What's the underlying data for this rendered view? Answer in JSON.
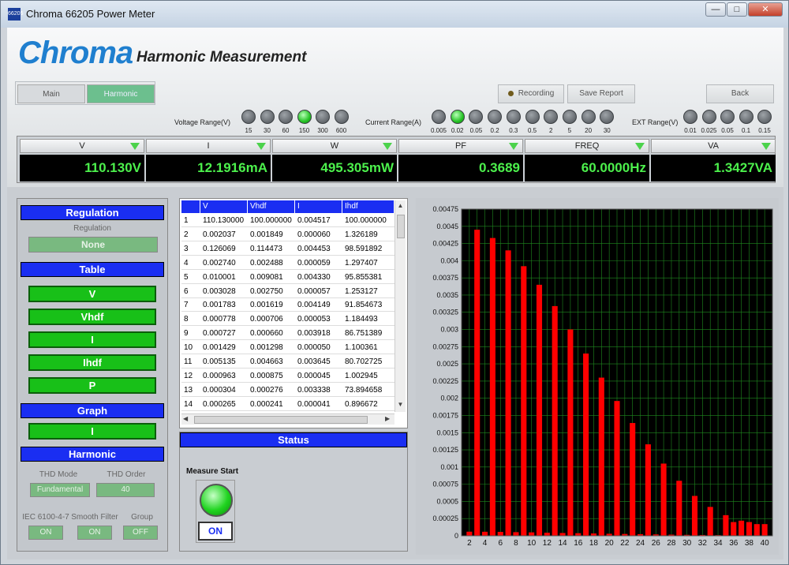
{
  "window": {
    "title": "Chroma 66205 Power Meter",
    "icon_text": "66205",
    "minimize": "—",
    "maximize": "□",
    "close": "✕"
  },
  "header": {
    "logo": "Chroma",
    "subtitle": "Harmonic Measurement",
    "tabs": [
      "Main",
      "Harmonic"
    ],
    "active_tab": "Harmonic",
    "recording_label": "Recording",
    "save_report_label": "Save Report",
    "back_label": "Back"
  },
  "ranges": {
    "voltage": {
      "label": "Voltage Range(V)",
      "options": [
        "15",
        "30",
        "60",
        "150",
        "300",
        "600"
      ],
      "selected": "150"
    },
    "current": {
      "label": "Current Range(A)",
      "options": [
        "0.005",
        "0.02",
        "0.05",
        "0.2",
        "0.3",
        "0.5",
        "2",
        "5",
        "20",
        "30"
      ],
      "selected": "0.02"
    },
    "ext": {
      "label": "EXT Range(V)",
      "options": [
        "0.01",
        "0.025",
        "0.05",
        "0.1",
        "0.15"
      ],
      "selected": ""
    }
  },
  "meters": [
    {
      "name": "V",
      "value": "110.130V"
    },
    {
      "name": "I",
      "value": "12.1916mA"
    },
    {
      "name": "W",
      "value": "495.305mW"
    },
    {
      "name": "PF",
      "value": "0.3689"
    },
    {
      "name": "FREQ",
      "value": "60.0000Hz"
    },
    {
      "name": "VA",
      "value": "1.3427VA"
    }
  ],
  "regulation": {
    "header": "Regulation",
    "label": "Regulation",
    "value": "None"
  },
  "table_section": {
    "header": "Table",
    "buttons": [
      "V",
      "Vhdf",
      "I",
      "Ihdf",
      "P"
    ]
  },
  "graph_section": {
    "header": "Graph",
    "button": "I"
  },
  "harmonic_section": {
    "header": "Harmonic",
    "thd_mode_label": "THD Mode",
    "thd_mode_value": "Fundamental",
    "thd_order_label": "THD Order",
    "thd_order_value": "40",
    "iec_label": "IEC 6100-4-7",
    "iec_value": "ON",
    "smooth_label": "Smooth Filter",
    "smooth_value": "ON",
    "group_label": "Group",
    "group_value": "OFF"
  },
  "data_table": {
    "columns": [
      "",
      "V",
      "Vhdf",
      "I",
      "Ihdf"
    ],
    "rows": [
      [
        "1",
        "110.130000",
        "100.000000",
        "0.004517",
        "100.000000"
      ],
      [
        "2",
        "0.002037",
        "0.001849",
        "0.000060",
        "1.326189"
      ],
      [
        "3",
        "0.126069",
        "0.114473",
        "0.004453",
        "98.591892"
      ],
      [
        "4",
        "0.002740",
        "0.002488",
        "0.000059",
        "1.297407"
      ],
      [
        "5",
        "0.010001",
        "0.009081",
        "0.004330",
        "95.855381"
      ],
      [
        "6",
        "0.003028",
        "0.002750",
        "0.000057",
        "1.253127"
      ],
      [
        "7",
        "0.001783",
        "0.001619",
        "0.004149",
        "91.854673"
      ],
      [
        "8",
        "0.000778",
        "0.000706",
        "0.000053",
        "1.184493"
      ],
      [
        "9",
        "0.000727",
        "0.000660",
        "0.003918",
        "86.751389"
      ],
      [
        "10",
        "0.001429",
        "0.001298",
        "0.000050",
        "1.100361"
      ],
      [
        "11",
        "0.005135",
        "0.004663",
        "0.003645",
        "80.702725"
      ],
      [
        "12",
        "0.000963",
        "0.000875",
        "0.000045",
        "1.002945"
      ],
      [
        "13",
        "0.000304",
        "0.000276",
        "0.003338",
        "73.894658"
      ],
      [
        "14",
        "0.000265",
        "0.000241",
        "0.000041",
        "0.896672"
      ]
    ]
  },
  "status": {
    "header": "Status",
    "measure_label": "Measure Start",
    "measure_value": "ON"
  },
  "colors": {
    "accent_blue": "#1a2ef2",
    "led_on": "#24c224",
    "bar": "#ff0000",
    "plot_bg": "#000000",
    "grid": "#1f8a1f",
    "meter_text": "#4cf04c"
  },
  "chart_data": {
    "type": "bar",
    "title": "",
    "xlabel": "",
    "ylabel": "",
    "ylim": [
      0,
      0.00475
    ],
    "xlim": [
      1,
      41
    ],
    "x_ticks": [
      "2",
      "4",
      "6",
      "8",
      "10",
      "12",
      "14",
      "16",
      "18",
      "20",
      "22",
      "24",
      "26",
      "28",
      "30",
      "32",
      "34",
      "36",
      "38",
      "40"
    ],
    "y_ticks": [
      "0",
      "0.00025",
      "0.0005",
      "0.00075",
      "0.001",
      "0.00125",
      "0.0015",
      "0.00175",
      "0.002",
      "0.00225",
      "0.0025",
      "0.00275",
      "0.003",
      "0.00325",
      "0.0035",
      "0.00375",
      "0.004",
      "0.00425",
      "0.0045",
      "0.00475"
    ],
    "grid": true,
    "series": [
      {
        "x": [
          2,
          3,
          4,
          5,
          6,
          7,
          8,
          9,
          10,
          11,
          12,
          13,
          14,
          15,
          16,
          17,
          18,
          19,
          20,
          21,
          22,
          23,
          24,
          25,
          26,
          27,
          28,
          29,
          30,
          31,
          32,
          33,
          34,
          35,
          36,
          37,
          38,
          39,
          40
        ],
        "values": [
          6e-05,
          0.00445,
          5.9e-05,
          0.00433,
          5.7e-05,
          0.00415,
          5.3e-05,
          0.00392,
          5e-05,
          0.00365,
          4.5e-05,
          0.00334,
          4.1e-05,
          0.003,
          3.8e-05,
          0.00265,
          3.4e-05,
          0.0023,
          3e-05,
          0.00196,
          2.7e-05,
          0.00164,
          2.4e-05,
          0.00133,
          2e-05,
          0.00105,
          1.7e-05,
          0.0008,
          1.4e-05,
          0.00058,
          1.2e-05,
          0.00042,
          1e-05,
          0.0003,
          0.0002,
          0.00022,
          0.0002,
          0.00017,
          0.00017
        ]
      }
    ]
  }
}
